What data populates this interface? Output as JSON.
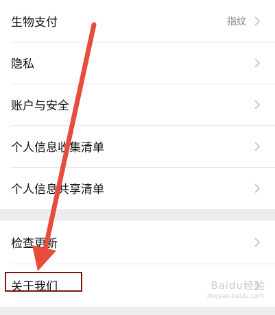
{
  "settings": {
    "items": [
      {
        "label": "生物支付",
        "value": "指纹"
      },
      {
        "label": "隐私",
        "value": ""
      },
      {
        "label": "账户与安全",
        "value": ""
      },
      {
        "label": "个人信息收集清单",
        "value": ""
      },
      {
        "label": "个人信息共享清单",
        "value": ""
      }
    ],
    "items2": [
      {
        "label": "检查更新"
      },
      {
        "label": "关于我们"
      }
    ]
  },
  "watermark": {
    "text": "Baidu经验",
    "sub": "jingyan.baidu.com"
  },
  "colors": {
    "arrow": "#e74c3c",
    "highlight_border": "#7a1414"
  }
}
